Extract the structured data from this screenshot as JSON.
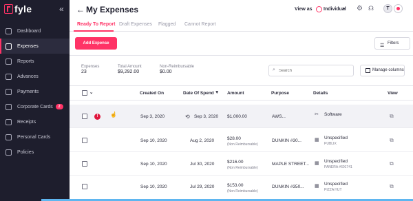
{
  "app": {
    "logo_text": "fyle"
  },
  "sidebar": {
    "items": [
      {
        "label": "Dashboard"
      },
      {
        "label": "Expenses"
      },
      {
        "label": "Reports"
      },
      {
        "label": "Advances"
      },
      {
        "label": "Payments"
      },
      {
        "label": "Corporate Cards",
        "badge": "2"
      },
      {
        "label": "Receipts"
      },
      {
        "label": "Personal Cards"
      },
      {
        "label": "Policies"
      }
    ]
  },
  "header": {
    "title": "My Expenses",
    "view_as_label": "View as",
    "role": "Individual",
    "avatar_initial": "T"
  },
  "tabs": [
    {
      "label": "Ready To Report"
    },
    {
      "label": "Draft Expenses"
    },
    {
      "label": "Flagged"
    },
    {
      "label": "Cannot Report"
    }
  ],
  "toolbar": {
    "add_label": "Add Expense",
    "filters_label": "Filters"
  },
  "stats": {
    "expenses_label": "Expenses",
    "expenses_value": "23",
    "total_label": "Total Amount",
    "total_value": "$9,292.00",
    "nonreimb_label": "Non-Reimbursable",
    "nonreimb_value": "$0.00"
  },
  "search": {
    "placeholder": "Search"
  },
  "manage_columns_label": "Manage columns",
  "table": {
    "headers": {
      "created_on": "Created On",
      "date_of_spend": "Date Of Spend",
      "amount": "Amount",
      "purpose": "Purpose",
      "details": "Details",
      "view": "View"
    },
    "rows": [
      {
        "created_on": "Sep 3, 2020",
        "date_of_spend": "Sep 3, 2020",
        "amount": "$1,000.00",
        "amount_note": "",
        "purpose": "AWS...",
        "details_title": "Software",
        "details_sub": ""
      },
      {
        "created_on": "Sep 10, 2020",
        "date_of_spend": "Aug 2, 2020",
        "amount": "$28.00",
        "amount_note": "(Non Reimbursable)",
        "purpose": "DUNKIN #30...",
        "details_title": "Unspecified",
        "details_sub": "PUBLIX"
      },
      {
        "created_on": "Sep 10, 2020",
        "date_of_spend": "Jul 30, 2020",
        "amount": "$216.00",
        "amount_note": "(Non Reimbursable)",
        "purpose": "MAPLE STREET...",
        "details_title": "Unspecified",
        "details_sub": "PANERA #601741"
      },
      {
        "created_on": "Sep 10, 2020",
        "date_of_spend": "Jul 29, 2020",
        "amount": "$153.00",
        "amount_note": "(Non Reimbursable)",
        "purpose": "DUNKIN #350...",
        "details_title": "Unspecified",
        "details_sub": "PIZZA HUT"
      }
    ]
  },
  "colors": {
    "accent": "#ff3366",
    "sidebar_bg": "#1e1e2d"
  }
}
